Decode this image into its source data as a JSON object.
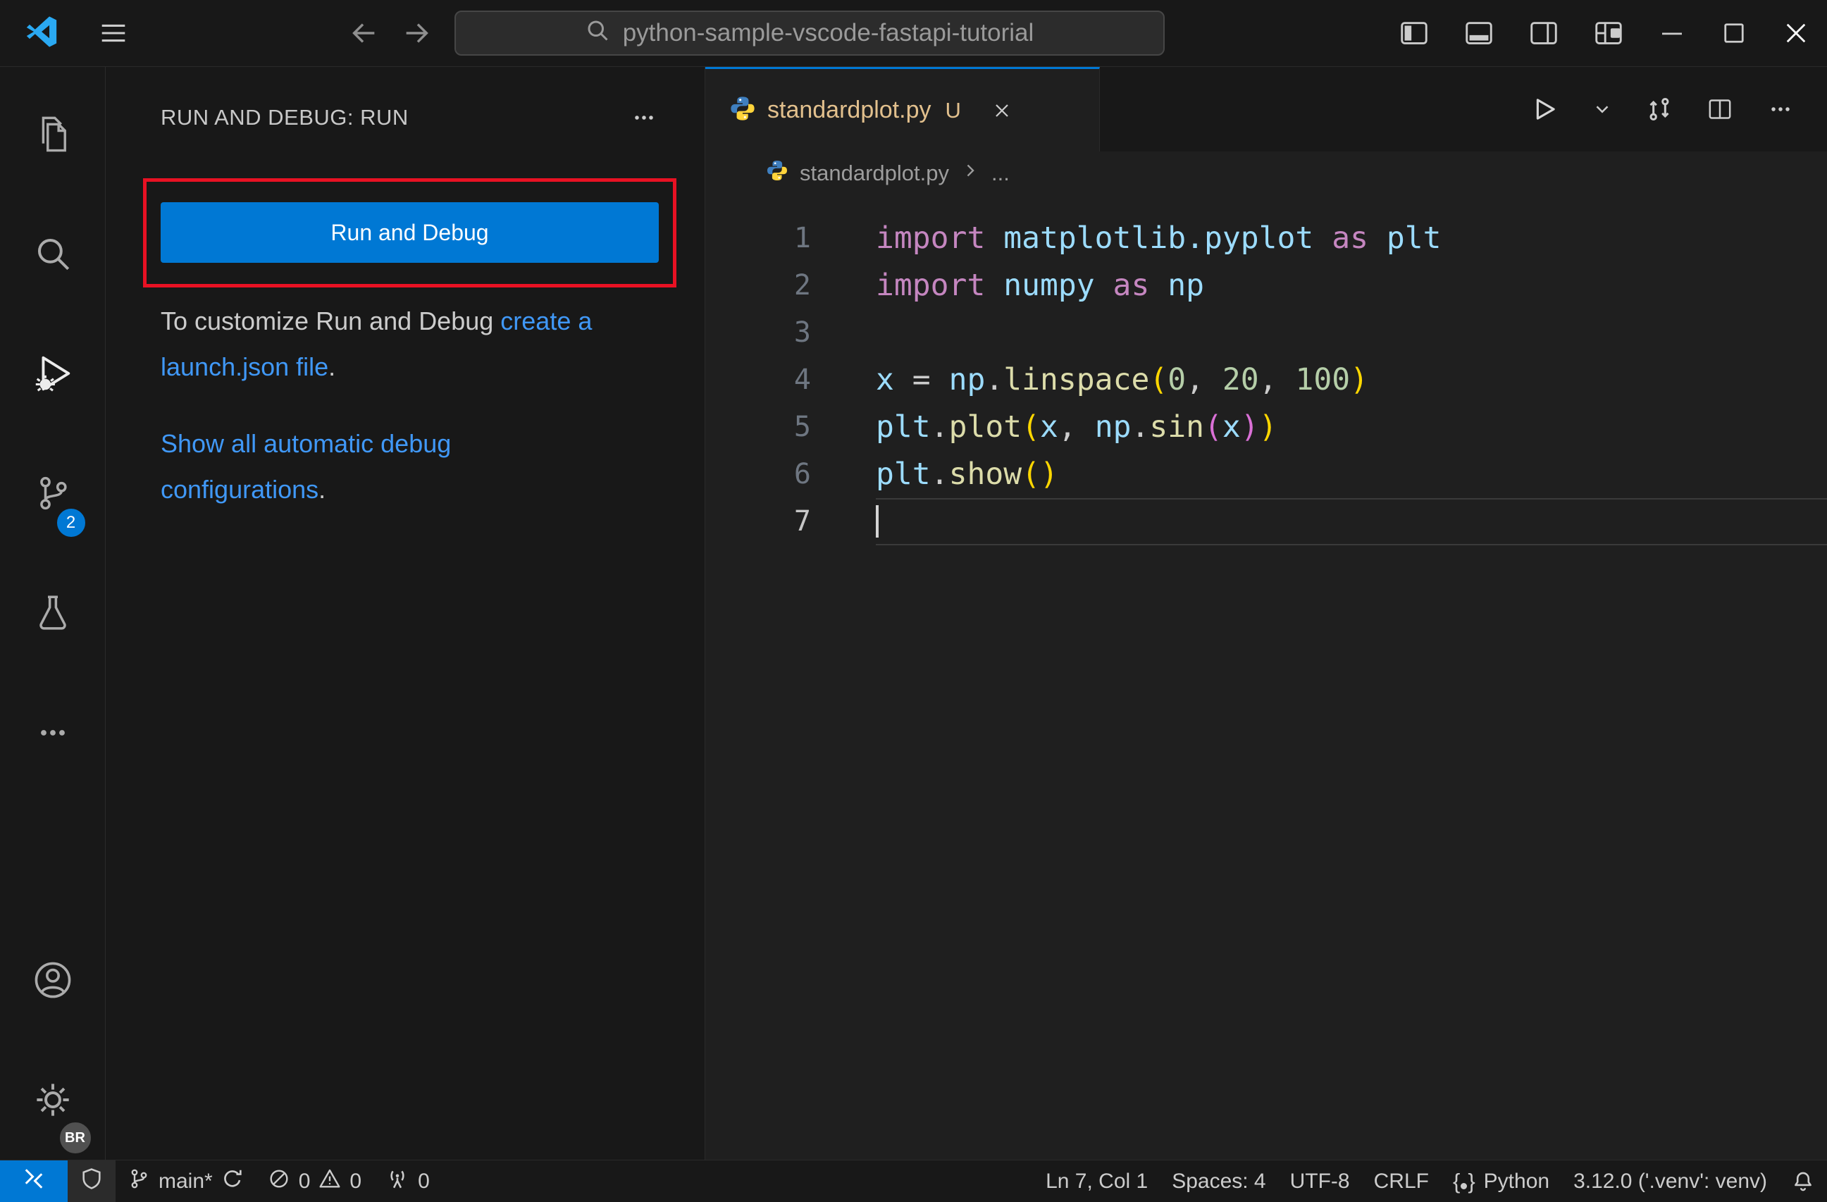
{
  "window": {
    "search_text": "python-sample-vscode-fastapi-tutorial"
  },
  "sidebar": {
    "header": "RUN AND DEBUG: RUN",
    "run_button_label": "Run and Debug",
    "customize_text": "To customize Run and Debug ",
    "customize_link": "create a launch.json file",
    "customize_period": ".",
    "show_configs_link": "Show all automatic debug configurations",
    "show_configs_period": "."
  },
  "activitybar": {
    "scm_badge": "2",
    "profile_badge": "BR"
  },
  "editor": {
    "tab": {
      "label": "standardplot.py",
      "git_status": "U"
    },
    "breadcrumb": {
      "file": "standardplot.py",
      "more": "..."
    },
    "code": [
      {
        "n": "1",
        "segs": [
          {
            "t": "import ",
            "c": "kw"
          },
          {
            "t": "matplotlib.pyplot",
            "c": "mod"
          },
          {
            "t": " as ",
            "c": "kw"
          },
          {
            "t": "plt",
            "c": "mod"
          }
        ]
      },
      {
        "n": "2",
        "segs": [
          {
            "t": "import ",
            "c": "kw"
          },
          {
            "t": "numpy",
            "c": "mod"
          },
          {
            "t": " as ",
            "c": "kw"
          },
          {
            "t": "np",
            "c": "mod"
          }
        ]
      },
      {
        "n": "3",
        "segs": []
      },
      {
        "n": "4",
        "segs": [
          {
            "t": "x ",
            "c": "var"
          },
          {
            "t": "= ",
            "c": "op"
          },
          {
            "t": "np",
            "c": "mod"
          },
          {
            "t": ".",
            "c": "op"
          },
          {
            "t": "linspace",
            "c": "fn"
          },
          {
            "t": "(",
            "c": "b1"
          },
          {
            "t": "0",
            "c": "num"
          },
          {
            "t": ", ",
            "c": "op"
          },
          {
            "t": "20",
            "c": "num"
          },
          {
            "t": ", ",
            "c": "op"
          },
          {
            "t": "100",
            "c": "num"
          },
          {
            "t": ")",
            "c": "b1"
          }
        ]
      },
      {
        "n": "5",
        "segs": [
          {
            "t": "plt",
            "c": "mod"
          },
          {
            "t": ".",
            "c": "op"
          },
          {
            "t": "plot",
            "c": "fn"
          },
          {
            "t": "(",
            "c": "b1"
          },
          {
            "t": "x",
            "c": "var"
          },
          {
            "t": ", ",
            "c": "op"
          },
          {
            "t": "np",
            "c": "mod"
          },
          {
            "t": ".",
            "c": "op"
          },
          {
            "t": "sin",
            "c": "fn"
          },
          {
            "t": "(",
            "c": "b2"
          },
          {
            "t": "x",
            "c": "var"
          },
          {
            "t": ")",
            "c": "b2"
          },
          {
            "t": ")",
            "c": "b1"
          }
        ]
      },
      {
        "n": "6",
        "segs": [
          {
            "t": "plt",
            "c": "mod"
          },
          {
            "t": ".",
            "c": "op"
          },
          {
            "t": "show",
            "c": "fn"
          },
          {
            "t": "(",
            "c": "b1"
          },
          {
            "t": ")",
            "c": "b1"
          }
        ]
      },
      {
        "n": "7",
        "segs": [],
        "current": true
      }
    ]
  },
  "statusbar": {
    "branch": "main*",
    "errors": "0",
    "warnings": "0",
    "ports": "0",
    "cursor_position": "Ln 7, Col 1",
    "indentation": "Spaces: 4",
    "encoding": "UTF-8",
    "eol": "CRLF",
    "brace_open": "{",
    "brace_close": "}",
    "language": "Python",
    "interpreter": "3.12.0 ('.venv': venv)"
  },
  "colors": {
    "accent_blue": "#0078d4",
    "annotation_red": "#e81123",
    "link_blue": "#4098f7",
    "tab_git": "#e2c08d"
  }
}
